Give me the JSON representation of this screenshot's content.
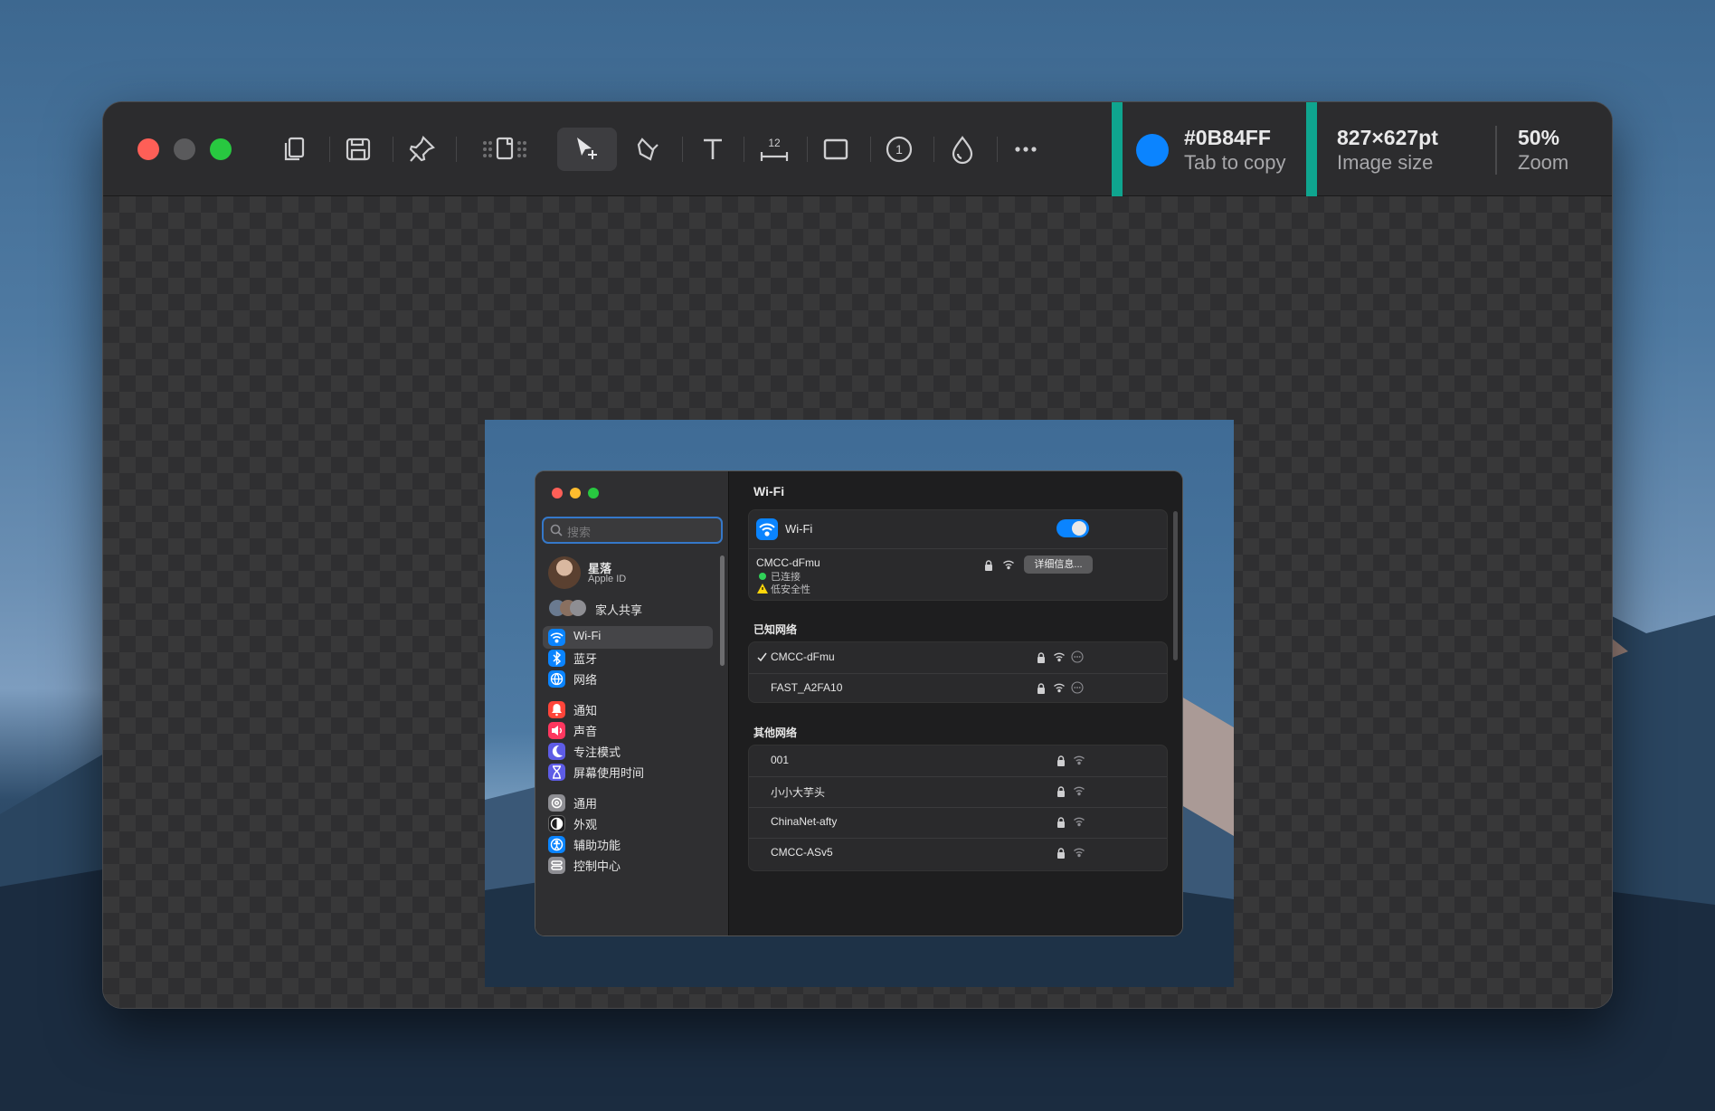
{
  "app": {
    "window_controls": [
      "close",
      "minimize",
      "zoom"
    ],
    "toolbar": {
      "icons": [
        "copy-icon",
        "save-icon",
        "pin-icon",
        "resize-icon",
        "select-icon",
        "pen-icon",
        "text-icon",
        "measure-icon",
        "rectangle-icon",
        "counter-icon",
        "color-picker-icon",
        "more-icon"
      ],
      "measure_badge": "12",
      "counter_badge": "1"
    },
    "color": {
      "hex": "#0B84FF",
      "hint": "Tab to copy"
    },
    "image_size": {
      "value": "827×627pt",
      "label": "Image size"
    },
    "zoom": {
      "value": "50%",
      "label": "Zoom"
    }
  },
  "settings": {
    "search_placeholder": "搜索",
    "account": {
      "name": "星落",
      "sub": "Apple ID",
      "family": "家人共享"
    },
    "sidebar_items": [
      {
        "label": "Wi-Fi",
        "icon": "wifi-icon",
        "color": "#0a84ff",
        "active": true
      },
      {
        "label": "蓝牙",
        "icon": "bluetooth-icon",
        "color": "#0a84ff"
      },
      {
        "label": "网络",
        "icon": "globe-icon",
        "color": "#0a84ff"
      },
      {
        "label": "通知",
        "icon": "bell-icon",
        "color": "#ff453a"
      },
      {
        "label": "声音",
        "icon": "speaker-icon",
        "color": "#ff375f"
      },
      {
        "label": "专注模式",
        "icon": "moon-icon",
        "color": "#5e5ce6"
      },
      {
        "label": "屏幕使用时间",
        "icon": "hourglass-icon",
        "color": "#5e5ce6"
      },
      {
        "label": "通用",
        "icon": "gear-icon",
        "color": "#8e8e93"
      },
      {
        "label": "外观",
        "icon": "appearance-icon",
        "color": "#1c1c1e"
      },
      {
        "label": "辅助功能",
        "icon": "accessibility-icon",
        "color": "#0a84ff"
      },
      {
        "label": "控制中心",
        "icon": "control-center-icon",
        "color": "#8e8e93"
      }
    ],
    "main": {
      "title": "Wi-Fi",
      "wifi_label": "Wi-Fi",
      "wifi_on": true,
      "current": {
        "name": "CMCC-dFmu",
        "status": "已连接",
        "warning": "低安全性",
        "details_button": "详细信息..."
      },
      "known_title": "已知网络",
      "known": [
        {
          "name": "CMCC-dFmu",
          "checked": true
        },
        {
          "name": "FAST_A2FA10",
          "checked": false
        }
      ],
      "other_title": "其他网络",
      "other": [
        {
          "name": "001"
        },
        {
          "name": "小小大芋头"
        },
        {
          "name": "ChinaNet-afty"
        },
        {
          "name": "CMCC-ASv5"
        }
      ]
    }
  }
}
